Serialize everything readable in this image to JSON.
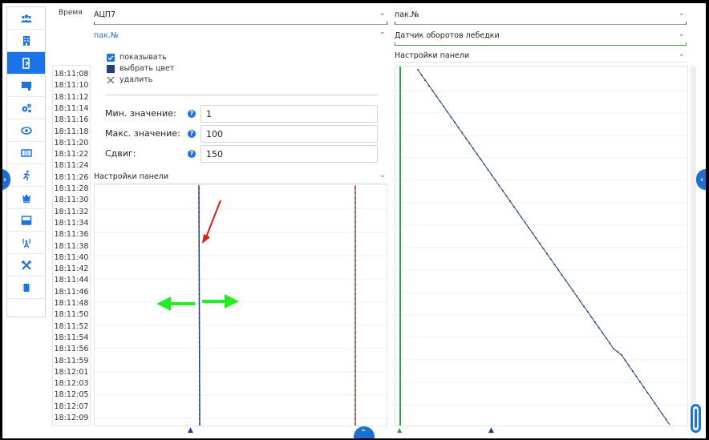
{
  "sidebar": {
    "items": [
      {
        "icon": "users-icon",
        "active": false
      },
      {
        "icon": "building-icon",
        "active": false
      },
      {
        "icon": "door-exit-icon",
        "active": true
      },
      {
        "icon": "monitor-icon",
        "active": false
      },
      {
        "icon": "gears-icon",
        "active": false
      },
      {
        "icon": "eye-icon",
        "active": false
      },
      {
        "icon": "film-icon",
        "active": false
      },
      {
        "icon": "running-man-icon",
        "active": false
      },
      {
        "icon": "crown-icon",
        "active": false
      },
      {
        "icon": "inbox-icon",
        "active": false
      },
      {
        "icon": "antenna-icon",
        "active": false
      },
      {
        "icon": "tools-icon",
        "active": false
      },
      {
        "icon": "chip-icon",
        "active": false
      }
    ],
    "accent": "#1a73e8"
  },
  "time": {
    "header": "Время",
    "rows": [
      "18:11:08",
      "18:11:10",
      "18:11:12",
      "18:11:14",
      "18:11:16",
      "18:11:18",
      "18:11:20",
      "18:11:22",
      "18:11:24",
      "18:11:26",
      "18:11:28",
      "18:11:30",
      "18:11:32",
      "18:11:34",
      "18:11:36",
      "18:11:38",
      "18:11:40",
      "18:11:42",
      "18:11:44",
      "18:11:46",
      "18:11:48",
      "18:11:50",
      "18:11:52",
      "18:11:54",
      "18:11:56",
      "18:11:59",
      "18:12:01",
      "18:12:03",
      "18:12:05",
      "18:12:07",
      "18:12:09"
    ]
  },
  "left": {
    "channel": "АЦП7",
    "param": "пак.№",
    "options": {
      "show": "показывать",
      "pick_color": "выбрать цвет",
      "delete": "удалить",
      "min_label": "Мин. значение:",
      "min_value": "1",
      "max_label": "Макс. значение:",
      "max_value": "100",
      "shift_label": "Сдвиг:",
      "shift_value": "150"
    },
    "panel_settings": "Настройки панели"
  },
  "right": {
    "channel": "пак.№",
    "param": "Датчик оборотов лебедки",
    "panel_settings": "Настройки панели"
  },
  "colors": {
    "series_blue": "#1f3f86",
    "series_red": "#b03030",
    "series_green": "#2e9e4a",
    "arrow_green": "#22ee22",
    "arrow_red": "#e21b1b"
  },
  "icons": {
    "chevron_down": "⌄",
    "chevron_up": "⌃",
    "help": "?",
    "marker": "▲"
  }
}
